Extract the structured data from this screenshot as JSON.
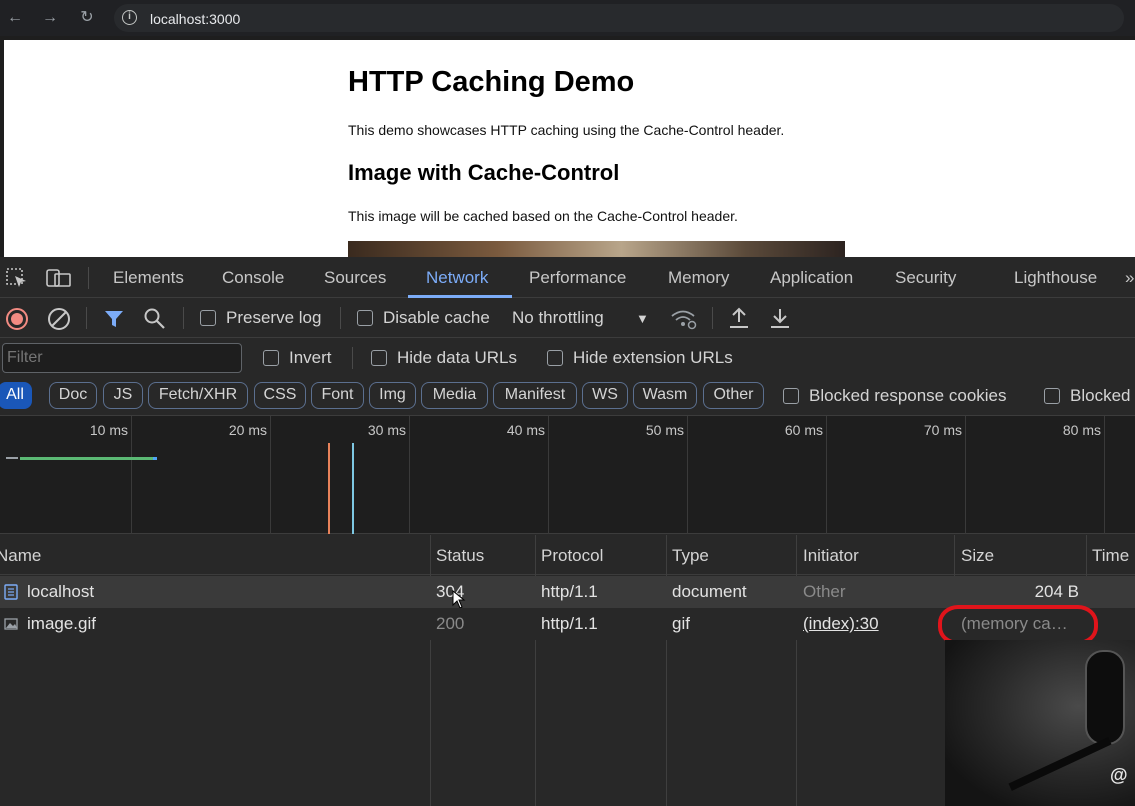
{
  "browser": {
    "url": "localhost:3000"
  },
  "page": {
    "title": "HTTP Caching Demo",
    "intro": "This demo showcases HTTP caching using the Cache-Control header.",
    "section_heading": "Image with Cache-Control",
    "section_text": "This image will be cached based on the Cache-Control header."
  },
  "devtools": {
    "tabs": [
      "Elements",
      "Console",
      "Sources",
      "Network",
      "Performance",
      "Memory",
      "Application",
      "Security",
      "Lighthouse"
    ],
    "active_tab": "Network",
    "toolbar": {
      "preserve_log": "Preserve log",
      "disable_cache": "Disable cache",
      "throttling": "No throttling"
    },
    "filter": {
      "placeholder": "Filter",
      "invert": "Invert",
      "hide_data_urls": "Hide data URLs",
      "hide_extension_urls": "Hide extension URLs"
    },
    "type_filters": [
      "All",
      "Doc",
      "JS",
      "Fetch/XHR",
      "CSS",
      "Font",
      "Img",
      "Media",
      "Manifest",
      "WS",
      "Wasm",
      "Other"
    ],
    "blocked_response_cookies": "Blocked response cookies",
    "blocked_requests": "Blocked",
    "timeline_ticks": [
      "10 ms",
      "20 ms",
      "30 ms",
      "40 ms",
      "50 ms",
      "60 ms",
      "70 ms",
      "80 ms"
    ],
    "columns": [
      "Name",
      "Status",
      "Protocol",
      "Type",
      "Initiator",
      "Size",
      "Time"
    ],
    "requests": [
      {
        "name": "localhost",
        "status": "304",
        "protocol": "http/1.1",
        "type": "document",
        "initiator": "Other",
        "size": "204 B"
      },
      {
        "name": "image.gif",
        "status": "200",
        "protocol": "http/1.1",
        "type": "gif",
        "initiator": "(index):30",
        "size": "(memory ca…"
      }
    ],
    "annotation_color": "#e0141b",
    "accent": "#7cacf8"
  },
  "overlay": {
    "handle": "@"
  }
}
